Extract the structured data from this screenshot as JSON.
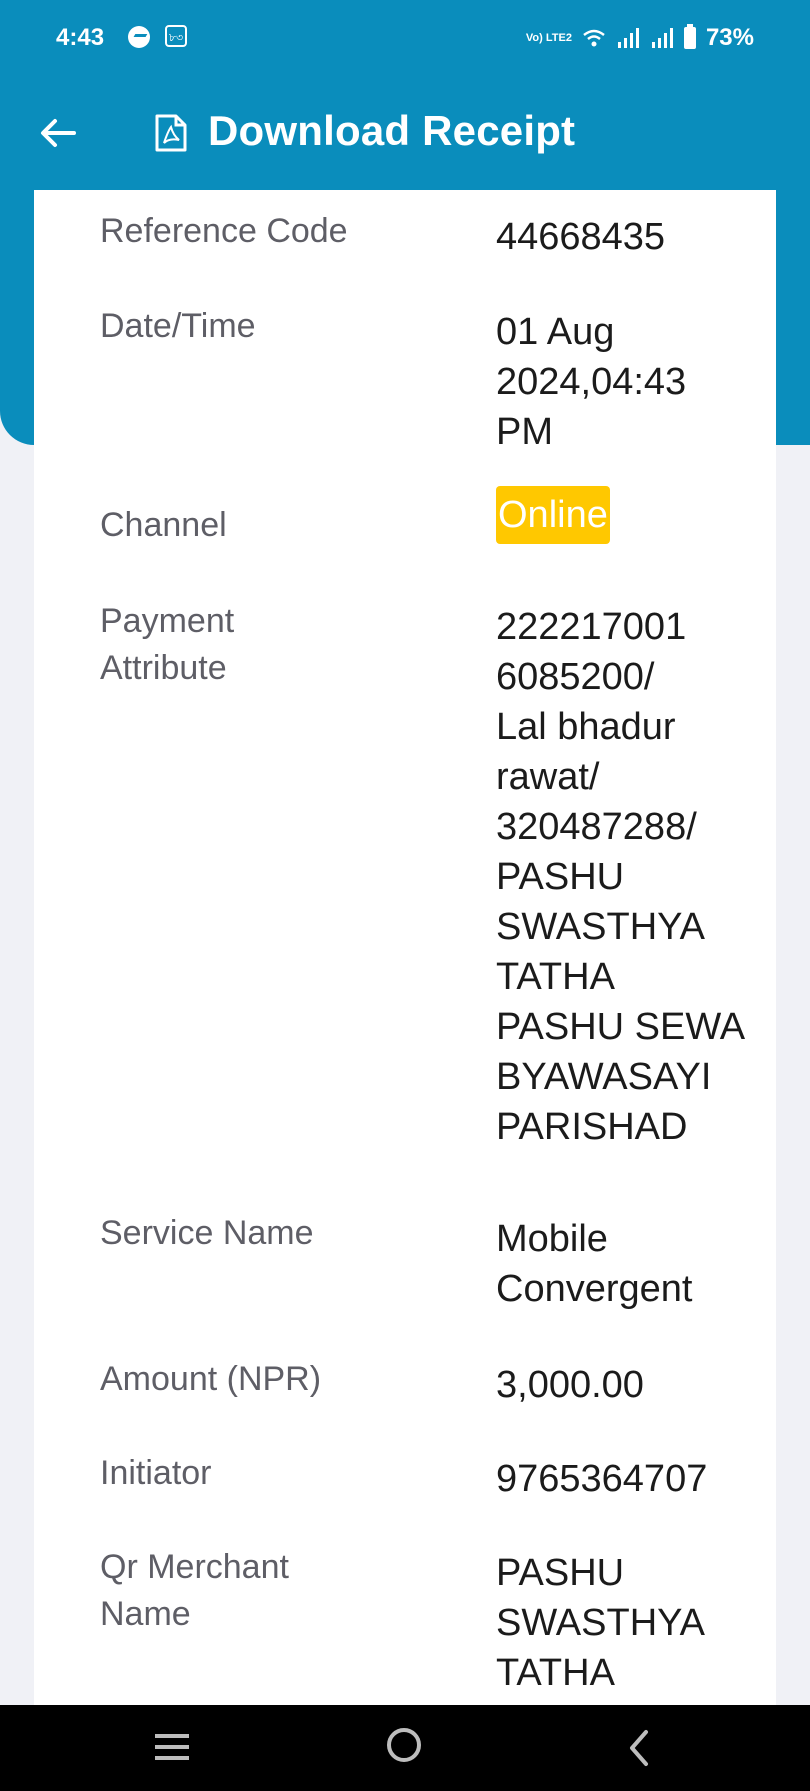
{
  "status_bar": {
    "time": "4:43",
    "box_label": "৮৩",
    "volte": "Vo) LTE2",
    "battery": "73%"
  },
  "app_bar": {
    "title": "Download Receipt"
  },
  "receipt": {
    "reference_code": {
      "label": "Reference Code",
      "value": "44668435"
    },
    "date_time": {
      "label": "Date/Time",
      "value_line1": "01 Aug",
      "value_line2": "2024,04:43",
      "value_line3": "PM"
    },
    "channel": {
      "label": "Channel",
      "value": "Online"
    },
    "payment_attribute": {
      "label_line1": "Payment",
      "label_line2": "Attribute",
      "lines": [
        "222217001",
        "6085200/",
        "Lal bhadur",
        "rawat/",
        "320487288/",
        "PASHU",
        "SWASTHYA",
        "TATHA",
        "PASHU SEWA",
        "BYAWASAYI",
        "PARISHAD"
      ]
    },
    "service_name": {
      "label": "Service Name",
      "value_line1": "Mobile",
      "value_line2": "Convergent"
    },
    "amount": {
      "label": "Amount (NPR)",
      "value": "3,000.00"
    },
    "initiator": {
      "label": "Initiator",
      "value": "9765364707"
    },
    "qr_merchant": {
      "label_line1": "Qr Merchant",
      "label_line2": "Name",
      "lines": [
        "PASHU",
        "SWASTHYA",
        "TATHA"
      ]
    }
  },
  "colors": {
    "header": "#0A8DBC",
    "badge": "#FFC800",
    "background": "#F0F1F6"
  },
  "icons": [
    "messenger-icon",
    "wifi-icon",
    "signal-icon",
    "battery-icon",
    "back-arrow-icon",
    "pdf-icon",
    "nav-menu-icon",
    "nav-home-icon",
    "nav-back-icon"
  ]
}
